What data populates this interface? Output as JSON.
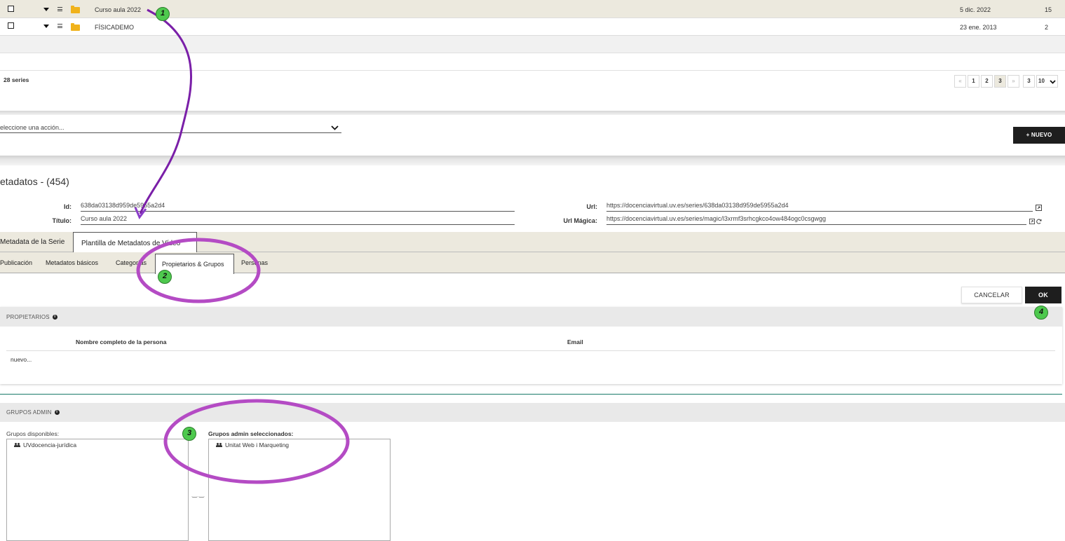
{
  "series_rows": [
    {
      "title": "Curso aula 2022",
      "date": "5 dic. 2022",
      "count": "15"
    },
    {
      "title": "FÍSICADEMO",
      "date": "23 ene. 2013",
      "count": "2"
    }
  ],
  "series_count": "28 series",
  "pagination": {
    "first": "«",
    "pages": [
      "1",
      "2",
      "3"
    ],
    "next": "»",
    "total": "3",
    "per_page": "10"
  },
  "action_select": {
    "value": "eleccione una acción..."
  },
  "new_button": "+ NUEVO",
  "metadata": {
    "heading": "etadatos - (454)",
    "id_label": "Id:",
    "id_value": "638da03138d959de5955a2d4",
    "title_label": "Título:",
    "title_value": "Curso aula 2022",
    "url_label": "Url:",
    "url_value": "https://docenciavirtual.uv.es/series/638da03138d959de5955a2d4",
    "magic_label": "Url Mágica:",
    "magic_value": "https://docenciavirtual.uv.es/series/magic/l3xrmf3srhcgkco4ow484ogc0csgwgg"
  },
  "main_tabs": [
    "Metadata de la Serie",
    "Plantilla de Metadatos de Vídeo"
  ],
  "sub_tabs": [
    "Publicación",
    "Metadatos básicos",
    "Categorías",
    "Propietarios & Grupos",
    "Personas"
  ],
  "buttons": {
    "cancel": "CANCELAR",
    "ok": "OK"
  },
  "owners": {
    "title": "PROPIETARIOS",
    "col_name": "Nombre completo de la persona",
    "col_email": "Email",
    "new_row": "nuevo..."
  },
  "groups": {
    "title": "GRUPOS ADMIN",
    "available_label": "Grupos disponibles:",
    "available_items": [
      "UVdocencia-jurídica"
    ],
    "selected_label": "Grupos admin seleccionados:",
    "selected_items": [
      "Unitat Web i Marqueting"
    ]
  },
  "markers": [
    "1",
    "2",
    "3",
    "4"
  ],
  "colors": {
    "annotation_purple": "#b44bc4",
    "arrow_purple": "#7a1fa8",
    "marker_green": "#4ec94e",
    "tab_bar_beige": "#ece9de",
    "dark_button": "#1e1e1e"
  }
}
